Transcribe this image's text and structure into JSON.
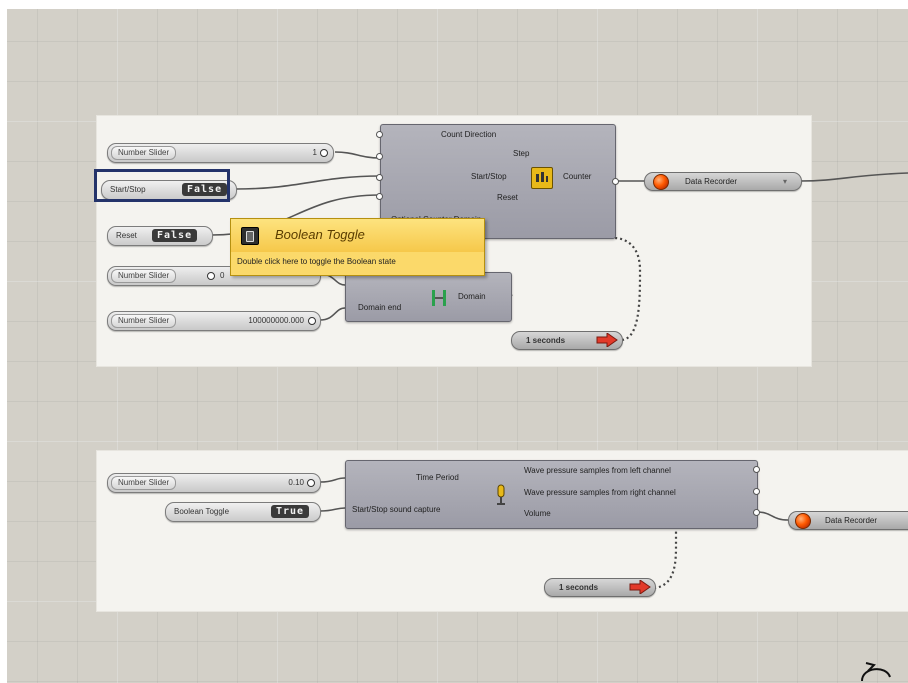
{
  "group1": {
    "slider1": {
      "label": "Number Slider",
      "value": "1"
    },
    "start_stop": {
      "label": "Start/Stop",
      "state": "False"
    },
    "reset": {
      "label": "Reset",
      "state": "False"
    },
    "slider2": {
      "label": "Number Slider",
      "value": "0"
    },
    "slider3": {
      "label": "Number Slider",
      "value": "100000000.000"
    },
    "counter": {
      "inputs": [
        "Count Direction",
        "Step",
        "Start/Stop",
        "Reset",
        "Optional Counter Domain"
      ],
      "output": "Counter"
    },
    "domain": {
      "inputs": [
        "Domain start",
        "Domain end"
      ],
      "output": "Domain"
    },
    "data_recorder": {
      "label": "Data Recorder"
    },
    "timer": {
      "label": "1 seconds"
    }
  },
  "tooltip": {
    "title": "Boolean Toggle",
    "description": "Double click here to toggle the Boolean state"
  },
  "group2": {
    "slider": {
      "label": "Number Slider",
      "value": "0.10"
    },
    "toggle": {
      "label": "Boolean Toggle",
      "state": "True"
    },
    "sound": {
      "inputs": [
        "Time Period",
        "Start/Stop sound capture"
      ],
      "outputs": [
        "Wave pressure samples from left channel",
        "Wave pressure samples from right channel",
        "Volume"
      ]
    },
    "data_recorder": {
      "label": "Data Recorder"
    },
    "timer": {
      "label": "1 seconds"
    }
  },
  "colors": {
    "canvas": "#d3d0c8",
    "group": "#f4f3ef",
    "component": "#a9a9b3",
    "tooltip": "#fbd96a",
    "highlight": "#24336a"
  }
}
